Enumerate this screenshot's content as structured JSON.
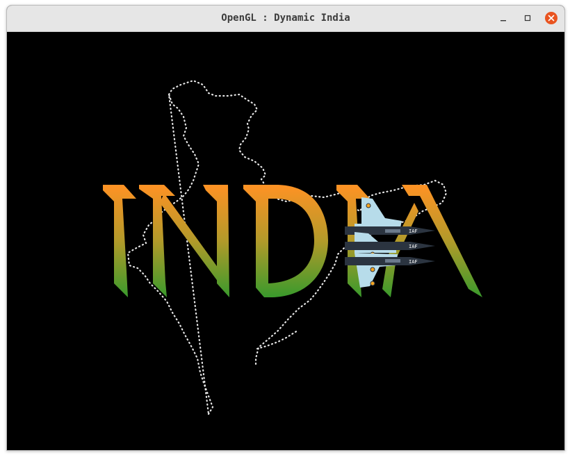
{
  "window": {
    "title": "OpenGL : Dynamic India",
    "controls": [
      "minimize-icon",
      "maximize-icon",
      "close-icon"
    ]
  },
  "scene": {
    "word": "INDIA",
    "letters": [
      "I",
      "N",
      "D",
      "I",
      "A"
    ],
    "map_outline": "india-map-dotted-outline",
    "aircraft": [
      {
        "name": "jet-top",
        "tail_text": "IAF"
      },
      {
        "name": "jet-middle",
        "tail_text": "IAF"
      },
      {
        "name": "jet-bottom",
        "tail_text": "IAF"
      }
    ],
    "colors": {
      "saffron": "#ff9224",
      "green": "#3c9a2c",
      "background": "#000000",
      "jet_wing": "#b7dcea",
      "jet_fuselage": "#2b3440",
      "close_button": "#e95420"
    }
  }
}
